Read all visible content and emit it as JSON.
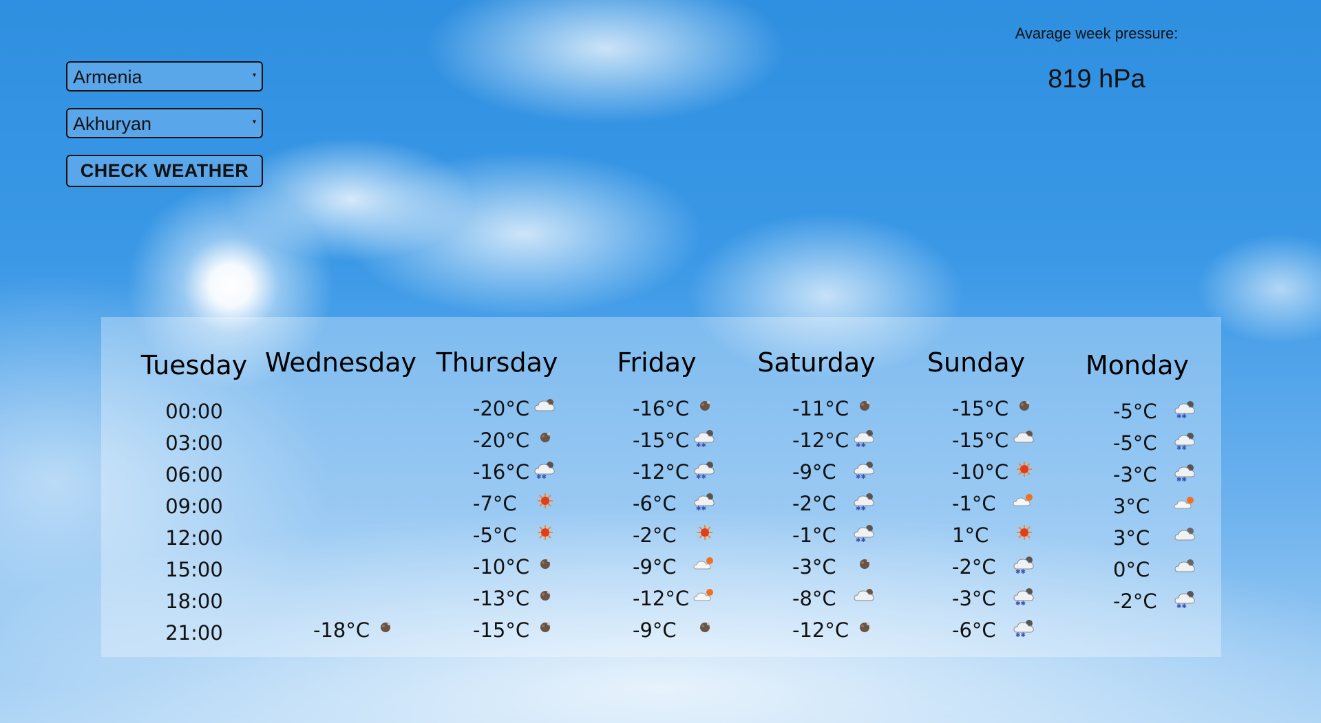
{
  "location": {
    "country": "Armenia",
    "city": "Akhuryan",
    "check_button_label": "CHECK WEATHER"
  },
  "pressure": {
    "label": "Avarage week pressure:",
    "value": "819 hPa"
  },
  "times": [
    "00:00",
    "03:00",
    "06:00",
    "09:00",
    "12:00",
    "15:00",
    "18:00",
    "21:00"
  ],
  "days": [
    {
      "name": "Tuesday",
      "forecast": []
    },
    {
      "name": "Wednesday",
      "forecast": [
        {
          "time": "21:00",
          "temp": "-18°C",
          "icon": "overcast-clouds-icon"
        }
      ]
    },
    {
      "name": "Thursday",
      "forecast": [
        {
          "time": "00:00",
          "temp": "-20°C",
          "icon": "broken-clouds-icon"
        },
        {
          "time": "03:00",
          "temp": "-20°C",
          "icon": "overcast-clouds-icon"
        },
        {
          "time": "06:00",
          "temp": "-16°C",
          "icon": "snow-icon"
        },
        {
          "time": "09:00",
          "temp": "-7°C",
          "icon": "clear-sky-icon"
        },
        {
          "time": "12:00",
          "temp": "-5°C",
          "icon": "clear-sky-icon"
        },
        {
          "time": "15:00",
          "temp": "-10°C",
          "icon": "overcast-clouds-icon"
        },
        {
          "time": "18:00",
          "temp": "-13°C",
          "icon": "overcast-clouds-icon"
        },
        {
          "time": "21:00",
          "temp": "-15°C",
          "icon": "overcast-clouds-icon"
        }
      ]
    },
    {
      "name": "Friday",
      "forecast": [
        {
          "time": "00:00",
          "temp": "-16°C",
          "icon": "overcast-clouds-icon"
        },
        {
          "time": "03:00",
          "temp": "-15°C",
          "icon": "snow-icon"
        },
        {
          "time": "06:00",
          "temp": "-12°C",
          "icon": "snow-icon"
        },
        {
          "time": "09:00",
          "temp": "-6°C",
          "icon": "snow-icon"
        },
        {
          "time": "12:00",
          "temp": "-2°C",
          "icon": "clear-sky-icon"
        },
        {
          "time": "15:00",
          "temp": "-9°C",
          "icon": "few-clouds-icon"
        },
        {
          "time": "18:00",
          "temp": "-12°C",
          "icon": "few-clouds-icon"
        },
        {
          "time": "21:00",
          "temp": "-9°C",
          "icon": "overcast-clouds-icon"
        }
      ]
    },
    {
      "name": "Saturday",
      "forecast": [
        {
          "time": "00:00",
          "temp": "-11°C",
          "icon": "overcast-clouds-icon"
        },
        {
          "time": "03:00",
          "temp": "-12°C",
          "icon": "snow-icon"
        },
        {
          "time": "06:00",
          "temp": "-9°C",
          "icon": "snow-icon"
        },
        {
          "time": "09:00",
          "temp": "-2°C",
          "icon": "snow-icon"
        },
        {
          "time": "12:00",
          "temp": "-1°C",
          "icon": "snow-icon"
        },
        {
          "time": "15:00",
          "temp": "-3°C",
          "icon": "overcast-clouds-icon"
        },
        {
          "time": "18:00",
          "temp": "-8°C",
          "icon": "broken-clouds-icon"
        },
        {
          "time": "21:00",
          "temp": "-12°C",
          "icon": "overcast-clouds-icon"
        }
      ]
    },
    {
      "name": "Sunday",
      "forecast": [
        {
          "time": "00:00",
          "temp": "-15°C",
          "icon": "overcast-clouds-icon"
        },
        {
          "time": "03:00",
          "temp": "-15°C",
          "icon": "broken-clouds-icon"
        },
        {
          "time": "06:00",
          "temp": "-10°C",
          "icon": "clear-sky-icon"
        },
        {
          "time": "09:00",
          "temp": "-1°C",
          "icon": "few-clouds-icon"
        },
        {
          "time": "12:00",
          "temp": "1°C",
          "icon": "clear-sky-icon"
        },
        {
          "time": "15:00",
          "temp": "-2°C",
          "icon": "snow-icon"
        },
        {
          "time": "18:00",
          "temp": "-3°C",
          "icon": "snow-icon"
        },
        {
          "time": "21:00",
          "temp": "-6°C",
          "icon": "snow-icon"
        }
      ]
    },
    {
      "name": "Monday",
      "forecast": [
        {
          "time": "00:00",
          "temp": "-5°C",
          "icon": "snow-icon"
        },
        {
          "time": "03:00",
          "temp": "-5°C",
          "icon": "snow-icon"
        },
        {
          "time": "06:00",
          "temp": "-3°C",
          "icon": "snow-icon"
        },
        {
          "time": "09:00",
          "temp": "3°C",
          "icon": "few-clouds-icon"
        },
        {
          "time": "12:00",
          "temp": "3°C",
          "icon": "scattered-clouds-icon"
        },
        {
          "time": "15:00",
          "temp": "0°C",
          "icon": "scattered-clouds-icon"
        },
        {
          "time": "18:00",
          "temp": "-2°C",
          "icon": "snow-icon"
        }
      ]
    }
  ]
}
